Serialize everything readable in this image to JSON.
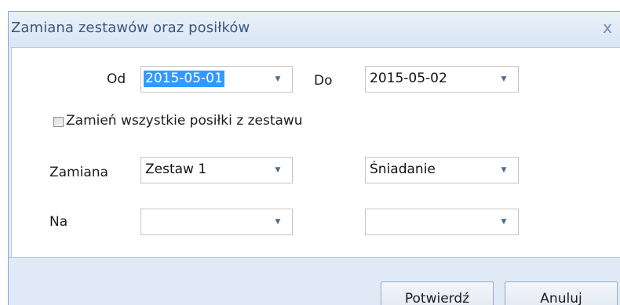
{
  "dialog": {
    "title": "Zamiana zestawów oraz posiłków",
    "close_label": "x"
  },
  "form": {
    "od_label": "Od",
    "od_value": "2015-05-01",
    "do_label": "Do",
    "do_value": "2015-05-02",
    "checkbox_label": "Zamień wszystkie posiłki z zestawu",
    "checkbox_checked": false,
    "zamiana_label": "Zamiana",
    "zamiana_set_value": "Zestaw 1",
    "zamiana_meal_value": "Śniadanie",
    "na_label": "Na",
    "na_set_value": "",
    "na_meal_value": ""
  },
  "icons": {
    "dropdown": "chevron-down-icon",
    "close": "close-icon"
  },
  "buttons": {
    "confirm_label": "Potwierdź",
    "cancel_label": "Anuluj"
  },
  "colors": {
    "title_text": "#39587f",
    "dialog_background": "#e2ecf7",
    "selection_highlight": "#3399ff"
  }
}
